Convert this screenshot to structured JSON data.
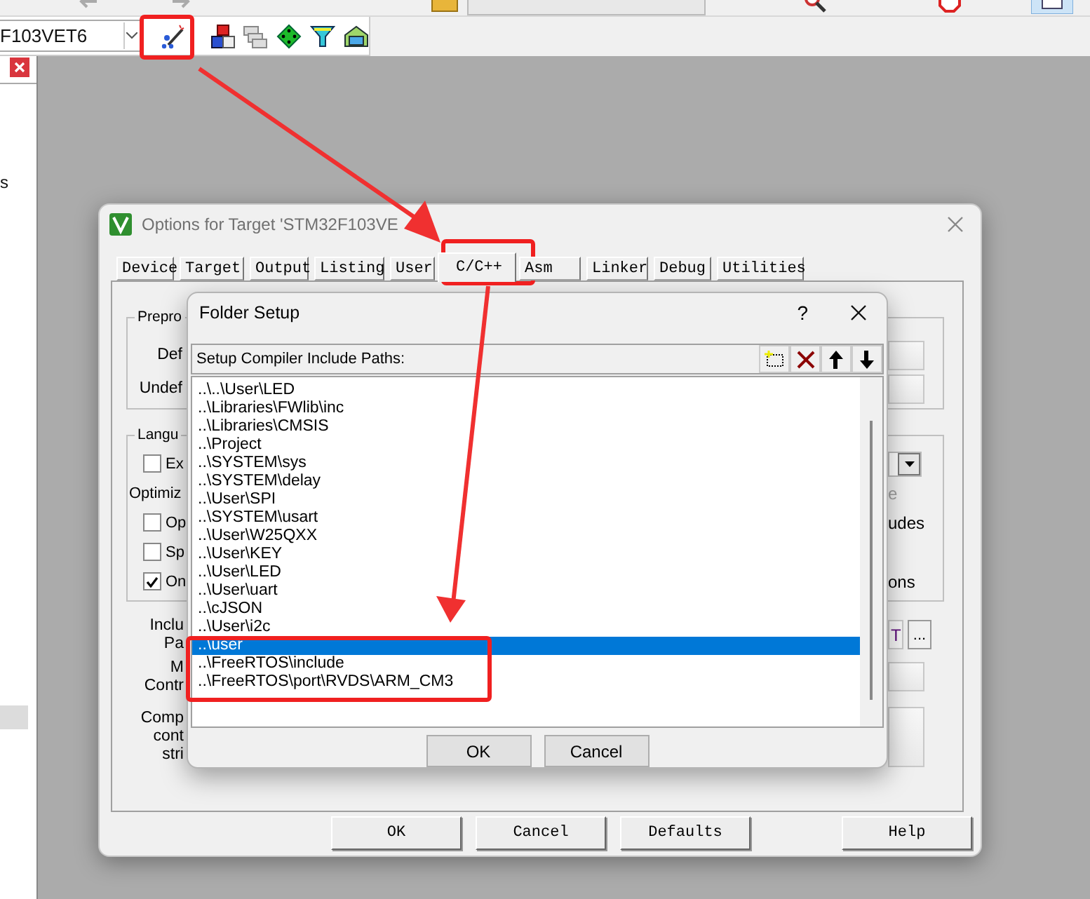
{
  "toolbar": {
    "target_combo": "F103VET6"
  },
  "side_panel": {
    "fragment": "s"
  },
  "options_dialog": {
    "title": "Options for Target 'STM32F103VE",
    "tabs": [
      {
        "label": "Device",
        "selected": false
      },
      {
        "label": "Target",
        "selected": false
      },
      {
        "label": "Output",
        "selected": false
      },
      {
        "label": "Listing",
        "selected": false
      },
      {
        "label": "User",
        "selected": false
      },
      {
        "label": "C/C++",
        "selected": true
      },
      {
        "label": "Asm",
        "selected": false
      },
      {
        "label": "Linker",
        "selected": false
      },
      {
        "label": "Debug",
        "selected": false
      },
      {
        "label": "Utilities",
        "selected": false
      }
    ],
    "preprocessor": {
      "legend": "Prepro",
      "rows": [
        "Def",
        "Undef"
      ]
    },
    "language": {
      "legend": "Langu",
      "rows": [
        {
          "kind": "checkbox",
          "label": "Ex",
          "checked": false,
          "right_dropdown": true
        },
        {
          "kind": "label",
          "label": "Optimiz",
          "right_text": "e",
          "right_disabled": true
        },
        {
          "kind": "checkbox",
          "label": "Op",
          "checked": false,
          "right_text": "udes",
          "right_disabled": false
        },
        {
          "kind": "checkbox",
          "label": "Sp",
          "checked": false
        },
        {
          "kind": "checkbox",
          "label": "On",
          "checked": true,
          "right_text": "ons",
          "right_disabled": false
        }
      ]
    },
    "fields": [
      {
        "label_lines": [
          "Inclu",
          "Pa"
        ],
        "value": "T",
        "browse": "..."
      },
      {
        "label_lines": [
          "M",
          "Contr"
        ]
      },
      {
        "label_lines": [
          "Comp",
          "cont",
          "stri"
        ],
        "multiline": true
      }
    ],
    "buttons": [
      "OK",
      "Cancel",
      "Defaults",
      "Help"
    ]
  },
  "folder_setup": {
    "title": "Folder Setup",
    "help": "?",
    "header": "Setup Compiler Include Paths:",
    "paths": [
      {
        "text": "..\\..\\User\\LED",
        "selected": false
      },
      {
        "text": "..\\Libraries\\FWlib\\inc",
        "selected": false
      },
      {
        "text": "..\\Libraries\\CMSIS",
        "selected": false
      },
      {
        "text": "..\\Project",
        "selected": false
      },
      {
        "text": "..\\SYSTEM\\sys",
        "selected": false
      },
      {
        "text": "..\\SYSTEM\\delay",
        "selected": false
      },
      {
        "text": "..\\User\\SPI",
        "selected": false
      },
      {
        "text": "..\\SYSTEM\\usart",
        "selected": false
      },
      {
        "text": "..\\User\\W25QXX",
        "selected": false
      },
      {
        "text": "..\\User\\KEY",
        "selected": false
      },
      {
        "text": "..\\User\\LED",
        "selected": false
      },
      {
        "text": "..\\User\\uart",
        "selected": false
      },
      {
        "text": "..\\cJSON",
        "selected": false
      },
      {
        "text": "..\\User\\i2c",
        "selected": false
      },
      {
        "text": "..\\user",
        "selected": true
      },
      {
        "text": "..\\FreeRTOS\\include",
        "selected": false
      },
      {
        "text": "..\\FreeRTOS\\port\\RVDS\\ARM_CM3",
        "selected": false
      }
    ],
    "buttons": [
      "OK",
      "Cancel"
    ]
  }
}
